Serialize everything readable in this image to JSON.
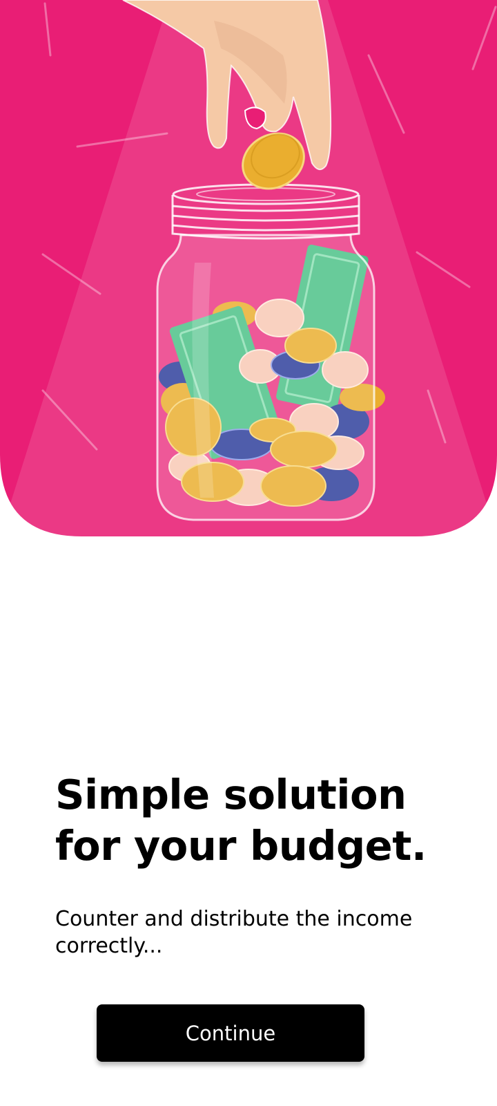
{
  "onboarding": {
    "illustration": "hand-dropping-coin-into-money-jar-icon",
    "title": "Simple solution for your budget.",
    "subtitle": "Counter and distribute the income correctly...",
    "continue_label": "Continue"
  },
  "colors": {
    "hero_background": "#E91E75",
    "accent_gold": "#EAAE2F",
    "accent_green": "#4CC287",
    "accent_navy": "#2E3F9B",
    "accent_peach": "#F8C9B4",
    "skin": "#F5C9A6",
    "button_background": "#000000",
    "button_text": "#FFFFFF"
  }
}
